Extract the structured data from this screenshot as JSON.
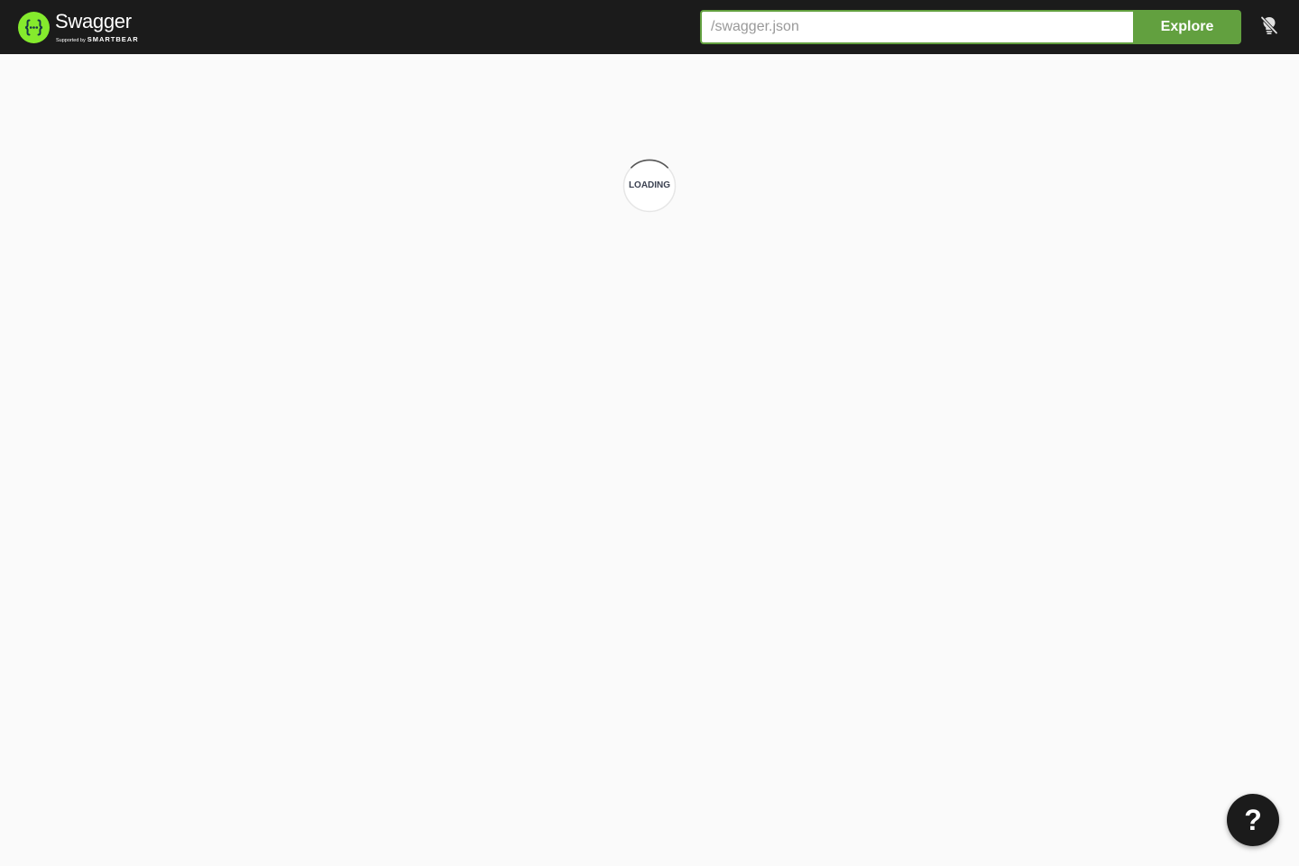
{
  "brand": {
    "name": "Swagger",
    "trademark": ".",
    "supported_by": "Supported by",
    "company": "SMARTBEAR",
    "logo_icon": "swagger-braces-logo",
    "accent_color": "#85ea2d"
  },
  "topbar": {
    "search": {
      "value": "",
      "placeholder": "/swagger.json"
    },
    "explore_label": "Explore",
    "explore_color": "#62a03f",
    "theme_toggle_icon": "lightbulb-off-icon"
  },
  "main": {
    "loading_label": "LOADING"
  },
  "help": {
    "label": "?"
  }
}
